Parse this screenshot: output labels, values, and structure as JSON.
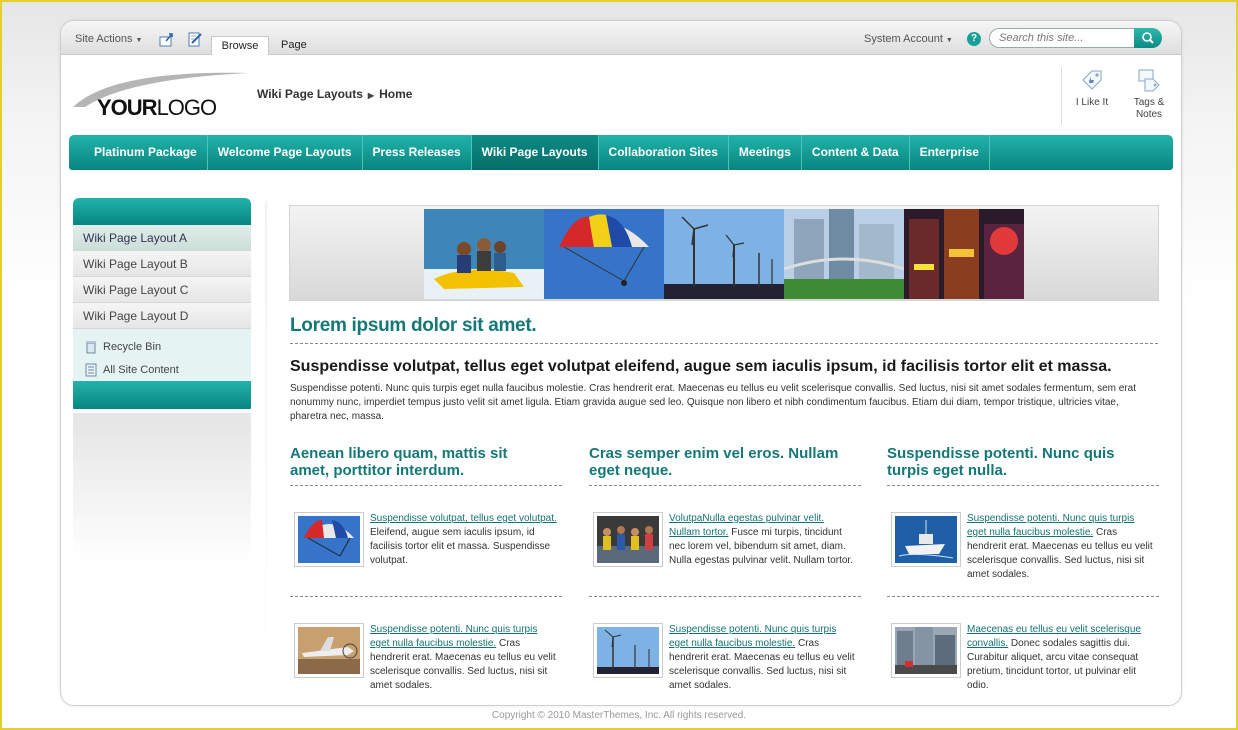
{
  "ribbon": {
    "site_actions": "Site Actions",
    "tabs": [
      "Browse",
      "Page"
    ],
    "account": "System Account",
    "search_placeholder": "Search this site..."
  },
  "header": {
    "logo_text_bold": "YOUR",
    "logo_text_rest": "LOGO",
    "breadcrumb": [
      "Wiki Page Layouts",
      "Home"
    ],
    "social": [
      {
        "label": "I Like It",
        "icon": "thumbs-up-tag-icon"
      },
      {
        "label": "Tags &",
        "label2": "Notes",
        "icon": "tags-notes-icon"
      }
    ]
  },
  "nav": {
    "items": [
      "Platinum Package",
      "Welcome Page Layouts",
      "Press Releases",
      "Wiki Page Layouts",
      "Collaboration Sites",
      "Meetings",
      "Content & Data",
      "Enterprise"
    ],
    "active": "Wiki Page Layouts"
  },
  "sidebar": {
    "items": [
      "Wiki Page Layout A",
      "Wiki Page Layout B",
      "Wiki Page Layout C",
      "Wiki Page Layout D"
    ],
    "links": [
      "Recycle Bin",
      "All Site Content"
    ]
  },
  "content": {
    "heading": "Lorem ipsum dolor sit amet.",
    "subheading": "Suspendisse volutpat, tellus eget volutpat eleifend, augue sem iaculis ipsum, id facilisis tortor elit et massa.",
    "intro": "Suspendisse potenti. Nunc quis turpis eget nulla faucibus molestie. Cras hendrerit erat. Maecenas eu tellus eu velit scelerisque convallis. Sed luctus, nisi sit amet sodales fermentum, sem erat nonummy nunc, imperdiet tempus justo velit sit amet ligula. Etiam gravida augue sed leo. Quisque non libero et nibh condimentum faucibus. Etiam dui diam, tempor tristique, ultricies vitae, pharetra nec, massa.",
    "columns": [
      {
        "title": "Aenean libero quam, mattis sit amet, porttitor interdum.",
        "items": [
          {
            "link": "Suspendisse volutpat, tellus eget volutpat.",
            "text": " Eleifend, augue sem iaculis ipsum, id facilisis tortor elit et massa. Suspendisse volutpat."
          },
          {
            "link": "Suspendisse potenti. Nunc quis turpis eget nulla faucibus molestie.",
            "text": " Cras hendrerit erat. Maecenas eu tellus eu velit scelerisque convallis. Sed luctus, nisi sit amet sodales."
          }
        ]
      },
      {
        "title": "Cras semper enim vel eros. Nullam eget neque.",
        "items": [
          {
            "link": "VolutpaNulla egestas pulvinar velit. Nullam tortor.",
            "text": " Fusce mi turpis, tincidunt nec lorem vel, bibendum sit amet, diam. Nulla egestas pulvinar velit. Nullam tortor."
          },
          {
            "link": "Suspendisse potenti. Nunc quis turpis eget nulla faucibus molestie.",
            "text": " Cras hendrerit erat. Maecenas eu tellus eu velit scelerisque convallis. Sed luctus, nisi sit amet sodales."
          }
        ]
      },
      {
        "title": "Suspendisse potenti. Nunc quis turpis eget nulla.",
        "items": [
          {
            "link": "Suspendisse potenti. Nunc quis turpis eget nulla faucibus molestie.",
            "text": " Cras hendrerit erat. Maecenas eu tellus eu velit scelerisque convallis. Sed luctus, nisi sit amet sodales."
          },
          {
            "link": "Maecenas eu tellus eu velit scelerisque convallis.",
            "text": " Donec sodales sagittis dui. Curabitur aliquet, arcu vitae consequat pretium, tincidunt tortor, ut pulvinar elit odio."
          }
        ]
      }
    ]
  },
  "footer": "Copyright © 2010 MasterThemes, Inc. All rights reserved.",
  "colors": {
    "teal": "#0f9a92",
    "heading_teal": "#147878",
    "frame": "#e4cf2e"
  }
}
